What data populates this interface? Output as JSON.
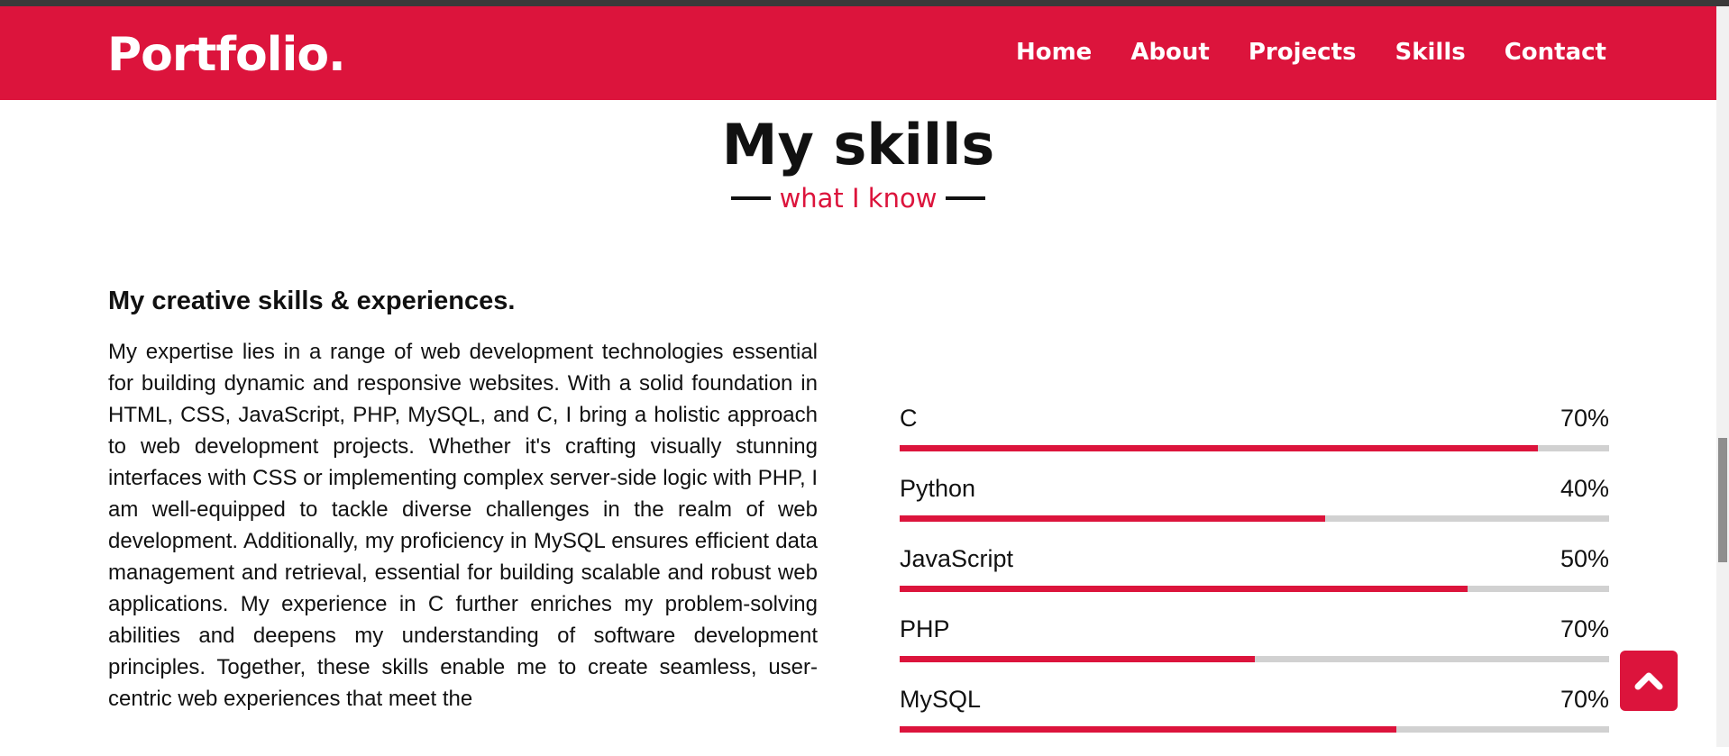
{
  "nav": {
    "logo": "Portfolio.",
    "links": [
      "Home",
      "About",
      "Projects",
      "Skills",
      "Contact"
    ]
  },
  "section": {
    "title": "My skills",
    "subtitle": "what I know"
  },
  "about": {
    "heading": "My creative skills & experiences.",
    "text": "My expertise lies in a range of web development technologies essential for building dynamic and responsive websites. With a solid foundation in HTML, CSS, JavaScript, PHP, MySQL, and C, I bring a holistic approach to web development projects. Whether it's crafting visually stunning interfaces with CSS or implementing complex server-side logic with PHP, I am well-equipped to tackle diverse challenges in the realm of web development. Additionally, my proficiency in MySQL ensures efficient data management and retrieval, essential for building scalable and robust web applications. My experience in C further enriches my problem-solving abilities and deepens my understanding of software development principles. Together, these skills enable me to create seamless, user-centric web experiences that meet the"
  },
  "skills": [
    {
      "name": "C",
      "percent_label": "70%",
      "bar_fraction": 0.9
    },
    {
      "name": "Python",
      "percent_label": "40%",
      "bar_fraction": 0.6
    },
    {
      "name": "JavaScript",
      "percent_label": "50%",
      "bar_fraction": 0.8
    },
    {
      "name": "PHP",
      "percent_label": "70%",
      "bar_fraction": 0.5
    },
    {
      "name": "MySQL",
      "percent_label": "70%",
      "bar_fraction": 0.7
    }
  ],
  "colors": {
    "accent": "#dc143c",
    "track": "#d1d1d1",
    "text": "#111111"
  },
  "icons": {
    "back_to_top": "chevron-up-icon"
  }
}
